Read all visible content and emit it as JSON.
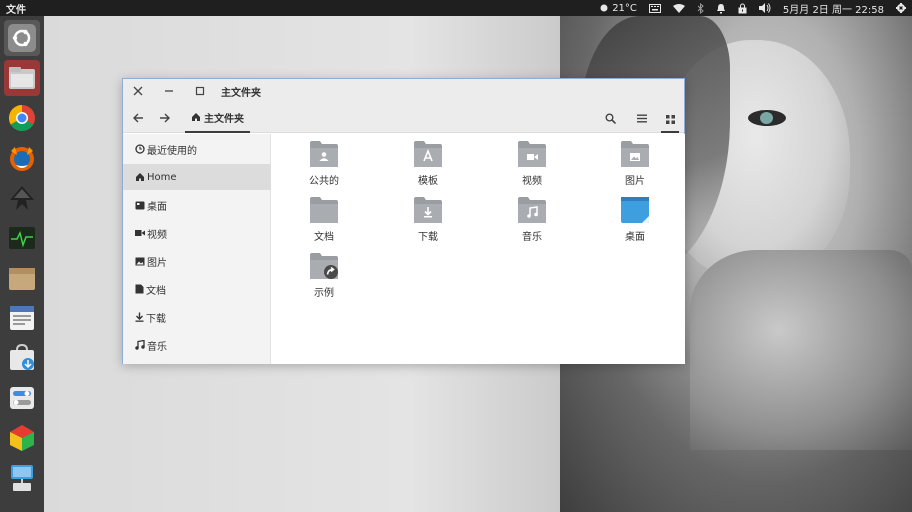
{
  "top_panel": {
    "app_name": "文件",
    "weather": "21°C",
    "clock": "5月月 2日 周一 22:58"
  },
  "launcher": {
    "items": [
      {
        "icon": "ubuntu-dash-icon"
      },
      {
        "icon": "files-app-icon"
      },
      {
        "icon": "chrome-icon"
      },
      {
        "icon": "firefox-icon"
      },
      {
        "icon": "inkscape-icon"
      },
      {
        "icon": "system-monitor-icon"
      },
      {
        "icon": "archive-icon"
      },
      {
        "icon": "document-viewer-icon"
      },
      {
        "icon": "software-center-icon"
      },
      {
        "icon": "settings-toggles-icon"
      },
      {
        "icon": "virtualbox-icon"
      },
      {
        "icon": "usb-creator-icon"
      }
    ]
  },
  "window": {
    "title": "主文件夹",
    "path_label": "主文件夹"
  },
  "sidebar": {
    "items": [
      {
        "label": "最近使用的",
        "icon": "clock-icon"
      },
      {
        "label": "Home",
        "icon": "home-icon"
      },
      {
        "label": "桌面",
        "icon": "desktop-icon"
      },
      {
        "label": "视频",
        "icon": "video-icon"
      },
      {
        "label": "图片",
        "icon": "picture-icon"
      },
      {
        "label": "文档",
        "icon": "document-icon"
      },
      {
        "label": "下载",
        "icon": "download-icon"
      },
      {
        "label": "音乐",
        "icon": "music-icon"
      }
    ]
  },
  "folders": [
    {
      "label": "公共的",
      "icon": "public-folder-icon"
    },
    {
      "label": "模板",
      "icon": "templates-folder-icon"
    },
    {
      "label": "视频",
      "icon": "videos-folder-icon"
    },
    {
      "label": "图片",
      "icon": "pictures-folder-icon"
    },
    {
      "label": "文档",
      "icon": "documents-folder-icon"
    },
    {
      "label": "下载",
      "icon": "downloads-folder-icon"
    },
    {
      "label": "音乐",
      "icon": "music-folder-icon"
    },
    {
      "label": "桌面",
      "icon": "desktop-folder-icon"
    },
    {
      "label": "示例",
      "icon": "examples-folder-icon"
    }
  ],
  "colors": {
    "folder_gray": "#9a9ea3",
    "desktop_folder_blue": "#3d9ee0",
    "panel_bg": "#1f1f1f",
    "launcher_bg": "#3d3d3d"
  }
}
